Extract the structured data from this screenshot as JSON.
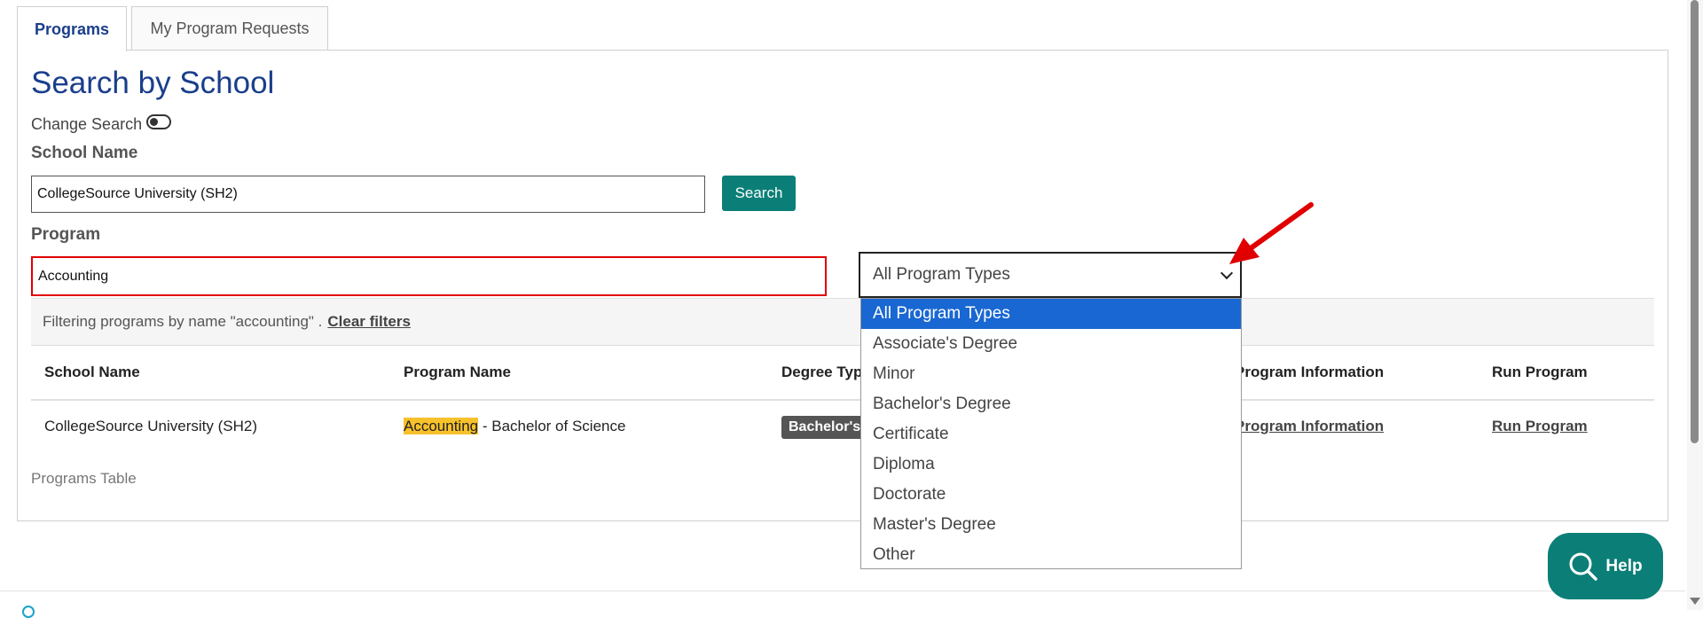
{
  "tabs": [
    {
      "label": "Programs",
      "active": true
    },
    {
      "label": "My Program Requests",
      "active": false
    }
  ],
  "page_title": "Search by School",
  "change_search_label": "Change Search",
  "school_name": {
    "label": "School Name",
    "value": "CollegeSource University (SH2)"
  },
  "search_button_label": "Search",
  "program": {
    "label": "Program",
    "value": "Accounting"
  },
  "program_type_select": {
    "selected": "All Program Types",
    "options": [
      "All Program Types",
      "Associate's Degree",
      "Minor",
      "Bachelor's Degree",
      "Certificate",
      "Diploma",
      "Doctorate",
      "Master's Degree",
      "Other"
    ]
  },
  "filter": {
    "text": "Filtering programs by name \"accounting\" .",
    "clear_label": "Clear filters"
  },
  "table": {
    "headers": [
      "School Name",
      "Program Name",
      "Degree Typ",
      "Program Information",
      "Run Program"
    ],
    "rows": [
      {
        "school": "CollegeSource University (SH2)",
        "program_highlight": "Accounting",
        "program_rest": " - Bachelor of Science",
        "degree_type": "Bachelor's",
        "program_info_link": "Program Information",
        "run_program_link": "Run Program"
      }
    ],
    "caption": "Programs Table"
  },
  "help_button_label": "Help",
  "colors": {
    "primary_teal": "#0b7f77",
    "title_blue": "#1a3e8c",
    "selected_option": "#1967d2",
    "highlight": "#f7c12b",
    "annotation_red": "#e00000"
  },
  "icons": [
    "toggle-icon",
    "chevron-down-icon",
    "search-icon",
    "red-arrow-annotation"
  ]
}
